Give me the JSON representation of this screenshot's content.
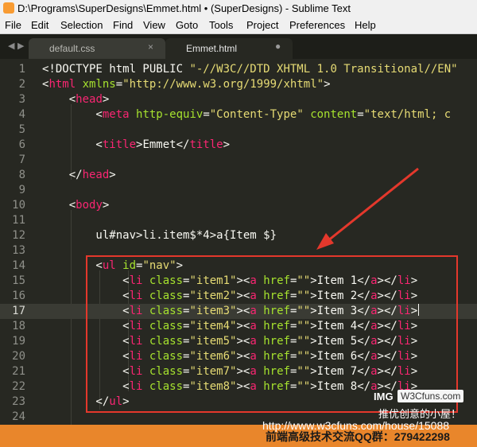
{
  "window": {
    "title": "D:\\Programs\\SuperDesigns\\Emmet.html • (SuperDesigns) - Sublime Text"
  },
  "menu": [
    "File",
    "Edit",
    "Selection",
    "Find",
    "View",
    "Goto",
    "Tools",
    "Project",
    "Preferences",
    "Help"
  ],
  "tab_nav": {
    "left": "◀",
    "right": "▶"
  },
  "tabs": [
    {
      "label": "default.css",
      "control": "×",
      "active": false
    },
    {
      "label": "Emmet.html",
      "control": "●",
      "active": true
    }
  ],
  "current_line": 17,
  "lines": [
    {
      "n": "1",
      "tokens": [
        [
          "txt",
          "<!DOCTYPE html PUBLIC "
        ],
        [
          "s",
          "\"-//W3C//DTD XHTML 1.0 Transitional//EN\""
        ]
      ]
    },
    {
      "n": "2",
      "tokens": [
        [
          "txt",
          "<"
        ],
        [
          "t",
          "html"
        ],
        [
          "txt",
          " "
        ],
        [
          "a",
          "xmlns"
        ],
        [
          "txt",
          "="
        ],
        [
          "s",
          "\"http://www.w3.org/1999/xhtml\""
        ],
        [
          "txt",
          ">"
        ]
      ]
    },
    {
      "n": "3",
      "tokens": [
        [
          "txt",
          "    <"
        ],
        [
          "t",
          "head"
        ],
        [
          "txt",
          ">"
        ]
      ]
    },
    {
      "n": "4",
      "tokens": [
        [
          "txt",
          "        <"
        ],
        [
          "t",
          "meta"
        ],
        [
          "txt",
          " "
        ],
        [
          "a",
          "http-equiv"
        ],
        [
          "txt",
          "="
        ],
        [
          "s",
          "\"Content-Type\""
        ],
        [
          "txt",
          " "
        ],
        [
          "a",
          "content"
        ],
        [
          "txt",
          "="
        ],
        [
          "s",
          "\"text/html; c"
        ]
      ]
    },
    {
      "n": "5",
      "tokens": []
    },
    {
      "n": "6",
      "tokens": [
        [
          "txt",
          "        <"
        ],
        [
          "t",
          "title"
        ],
        [
          "txt",
          ">Emmet</"
        ],
        [
          "t",
          "title"
        ],
        [
          "txt",
          ">"
        ]
      ]
    },
    {
      "n": "7",
      "tokens": []
    },
    {
      "n": "8",
      "tokens": [
        [
          "txt",
          "    </"
        ],
        [
          "t",
          "head"
        ],
        [
          "txt",
          ">"
        ]
      ]
    },
    {
      "n": "9",
      "tokens": []
    },
    {
      "n": "10",
      "tokens": [
        [
          "txt",
          "    <"
        ],
        [
          "t",
          "body"
        ],
        [
          "txt",
          ">"
        ]
      ]
    },
    {
      "n": "11",
      "tokens": []
    },
    {
      "n": "12",
      "tokens": [
        [
          "txt",
          "        ul#nav>li.item$*4>a{Item $}"
        ]
      ]
    },
    {
      "n": "13",
      "tokens": []
    },
    {
      "n": "14",
      "tokens": [
        [
          "txt",
          "        <"
        ],
        [
          "t",
          "ul"
        ],
        [
          "txt",
          " "
        ],
        [
          "a",
          "id"
        ],
        [
          "txt",
          "="
        ],
        [
          "s",
          "\"nav\""
        ],
        [
          "txt",
          ">"
        ]
      ]
    },
    {
      "n": "15",
      "tokens": [
        [
          "txt",
          "            <"
        ],
        [
          "t",
          "li"
        ],
        [
          "txt",
          " "
        ],
        [
          "a",
          "class"
        ],
        [
          "txt",
          "="
        ],
        [
          "s",
          "\"item1\""
        ],
        [
          "txt",
          "><"
        ],
        [
          "t",
          "a"
        ],
        [
          "txt",
          " "
        ],
        [
          "a",
          "href"
        ],
        [
          "txt",
          "="
        ],
        [
          "s",
          "\"\""
        ],
        [
          "txt",
          ">Item 1</"
        ],
        [
          "t",
          "a"
        ],
        [
          "txt",
          "></"
        ],
        [
          "t",
          "li"
        ],
        [
          "txt",
          ">"
        ]
      ]
    },
    {
      "n": "16",
      "tokens": [
        [
          "txt",
          "            <"
        ],
        [
          "t",
          "li"
        ],
        [
          "txt",
          " "
        ],
        [
          "a",
          "class"
        ],
        [
          "txt",
          "="
        ],
        [
          "s",
          "\"item2\""
        ],
        [
          "txt",
          "><"
        ],
        [
          "t",
          "a"
        ],
        [
          "txt",
          " "
        ],
        [
          "a",
          "href"
        ],
        [
          "txt",
          "="
        ],
        [
          "s",
          "\"\""
        ],
        [
          "txt",
          ">Item 2</"
        ],
        [
          "t",
          "a"
        ],
        [
          "txt",
          "></"
        ],
        [
          "t",
          "li"
        ],
        [
          "txt",
          ">"
        ]
      ]
    },
    {
      "n": "17",
      "tokens": [
        [
          "txt",
          "            <"
        ],
        [
          "t",
          "li"
        ],
        [
          "txt",
          " "
        ],
        [
          "a",
          "class"
        ],
        [
          "txt",
          "="
        ],
        [
          "s",
          "\"item3\""
        ],
        [
          "txt",
          "><"
        ],
        [
          "t",
          "a"
        ],
        [
          "txt",
          " "
        ],
        [
          "a",
          "href"
        ],
        [
          "txt",
          "="
        ],
        [
          "s",
          "\"\""
        ],
        [
          "txt",
          ">Item 3</"
        ],
        [
          "t",
          "a"
        ],
        [
          "txt",
          "></"
        ],
        [
          "t",
          "li"
        ],
        [
          "txt",
          ">"
        ]
      ]
    },
    {
      "n": "18",
      "tokens": [
        [
          "txt",
          "            <"
        ],
        [
          "t",
          "li"
        ],
        [
          "txt",
          " "
        ],
        [
          "a",
          "class"
        ],
        [
          "txt",
          "="
        ],
        [
          "s",
          "\"item4\""
        ],
        [
          "txt",
          "><"
        ],
        [
          "t",
          "a"
        ],
        [
          "txt",
          " "
        ],
        [
          "a",
          "href"
        ],
        [
          "txt",
          "="
        ],
        [
          "s",
          "\"\""
        ],
        [
          "txt",
          ">Item 4</"
        ],
        [
          "t",
          "a"
        ],
        [
          "txt",
          "></"
        ],
        [
          "t",
          "li"
        ],
        [
          "txt",
          ">"
        ]
      ]
    },
    {
      "n": "19",
      "tokens": [
        [
          "txt",
          "            <"
        ],
        [
          "t",
          "li"
        ],
        [
          "txt",
          " "
        ],
        [
          "a",
          "class"
        ],
        [
          "txt",
          "="
        ],
        [
          "s",
          "\"item5\""
        ],
        [
          "txt",
          "><"
        ],
        [
          "t",
          "a"
        ],
        [
          "txt",
          " "
        ],
        [
          "a",
          "href"
        ],
        [
          "txt",
          "="
        ],
        [
          "s",
          "\"\""
        ],
        [
          "txt",
          ">Item 5</"
        ],
        [
          "t",
          "a"
        ],
        [
          "txt",
          "></"
        ],
        [
          "t",
          "li"
        ],
        [
          "txt",
          ">"
        ]
      ]
    },
    {
      "n": "20",
      "tokens": [
        [
          "txt",
          "            <"
        ],
        [
          "t",
          "li"
        ],
        [
          "txt",
          " "
        ],
        [
          "a",
          "class"
        ],
        [
          "txt",
          "="
        ],
        [
          "s",
          "\"item6\""
        ],
        [
          "txt",
          "><"
        ],
        [
          "t",
          "a"
        ],
        [
          "txt",
          " "
        ],
        [
          "a",
          "href"
        ],
        [
          "txt",
          "="
        ],
        [
          "s",
          "\"\""
        ],
        [
          "txt",
          ">Item 6</"
        ],
        [
          "t",
          "a"
        ],
        [
          "txt",
          "></"
        ],
        [
          "t",
          "li"
        ],
        [
          "txt",
          ">"
        ]
      ]
    },
    {
      "n": "21",
      "tokens": [
        [
          "txt",
          "            <"
        ],
        [
          "t",
          "li"
        ],
        [
          "txt",
          " "
        ],
        [
          "a",
          "class"
        ],
        [
          "txt",
          "="
        ],
        [
          "s",
          "\"item7\""
        ],
        [
          "txt",
          "><"
        ],
        [
          "t",
          "a"
        ],
        [
          "txt",
          " "
        ],
        [
          "a",
          "href"
        ],
        [
          "txt",
          "="
        ],
        [
          "s",
          "\"\""
        ],
        [
          "txt",
          ">Item 7</"
        ],
        [
          "t",
          "a"
        ],
        [
          "txt",
          "></"
        ],
        [
          "t",
          "li"
        ],
        [
          "txt",
          ">"
        ]
      ]
    },
    {
      "n": "22",
      "tokens": [
        [
          "txt",
          "            <"
        ],
        [
          "t",
          "li"
        ],
        [
          "txt",
          " "
        ],
        [
          "a",
          "class"
        ],
        [
          "txt",
          "="
        ],
        [
          "s",
          "\"item8\""
        ],
        [
          "txt",
          "><"
        ],
        [
          "t",
          "a"
        ],
        [
          "txt",
          " "
        ],
        [
          "a",
          "href"
        ],
        [
          "txt",
          "="
        ],
        [
          "s",
          "\"\""
        ],
        [
          "txt",
          ">Item 8</"
        ],
        [
          "t",
          "a"
        ],
        [
          "txt",
          "></"
        ],
        [
          "t",
          "li"
        ],
        [
          "txt",
          ">"
        ]
      ]
    },
    {
      "n": "23",
      "tokens": [
        [
          "txt",
          "        </"
        ],
        [
          "t",
          "ul"
        ],
        [
          "txt",
          ">"
        ]
      ]
    },
    {
      "n": "24",
      "tokens": []
    }
  ],
  "watermark": {
    "logo": "IMG",
    "logo_box": "W3Cfuns.com",
    "tagline": "推优创意的小屋！",
    "url": "http://www.w3cfuns.com/house/15088",
    "qq": "前端高级技术交流QQ群：279422298"
  },
  "colors": {
    "editor_bg": "#272822",
    "tag": "#f92672",
    "attribute": "#a6e22e",
    "string": "#e6db74",
    "highlight_box": "#e4382c",
    "watermark_bar": "#e9862b"
  }
}
